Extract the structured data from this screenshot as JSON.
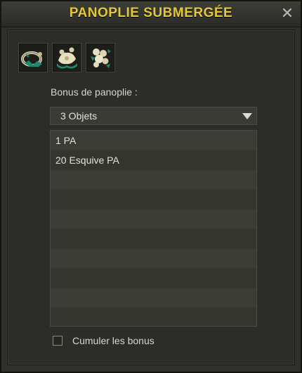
{
  "window": {
    "title": "PANOPLIE SUBMERGÉE",
    "close_symbol": "✕"
  },
  "items": [
    {
      "name": "ring-item-icon"
    },
    {
      "name": "shell-item-icon"
    },
    {
      "name": "pearl-item-icon"
    }
  ],
  "bonus": {
    "label": "Bonus de panoplie :",
    "selected": "3 Objets",
    "rows": [
      "1 PA",
      "20 Esquive PA",
      "",
      "",
      "",
      "",
      "",
      "",
      "",
      ""
    ]
  },
  "cumulate": {
    "label": "Cumuler les bonus",
    "checked": false
  },
  "colors": {
    "title": "#e5c73a",
    "background": "#2f302b"
  }
}
